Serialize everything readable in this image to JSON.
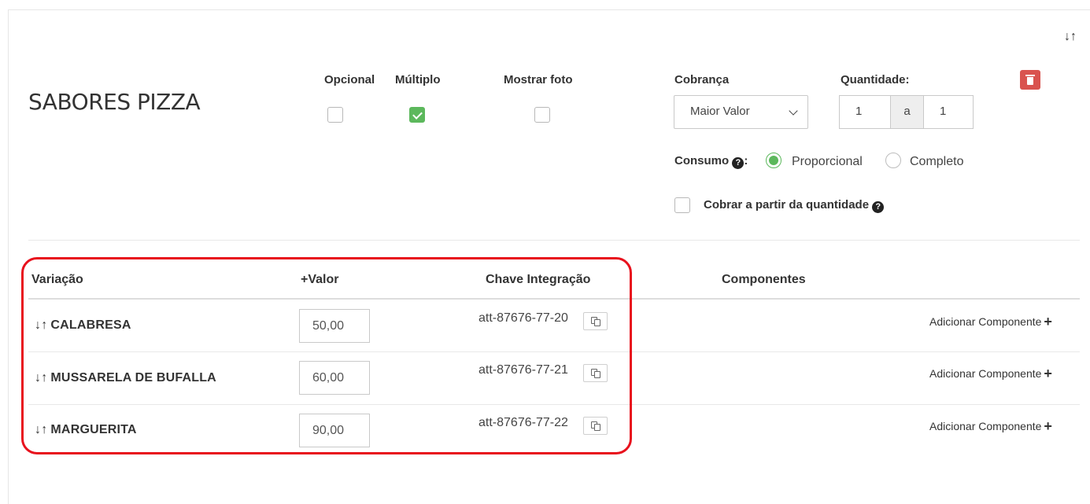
{
  "group": {
    "title": "SABORES PIZZA",
    "sort_icon": "↓↑",
    "delete_icon": "trash-icon"
  },
  "options": {
    "opcional": {
      "label": "Opcional",
      "checked": false
    },
    "multiplo": {
      "label": "Múltiplo",
      "checked": true
    },
    "mostrar_foto": {
      "label": "Mostrar foto",
      "checked": false
    }
  },
  "cobranca": {
    "label": "Cobrança",
    "selected": "Maior Valor"
  },
  "quantidade": {
    "label": "Quantidade:",
    "min": "1",
    "separator": "a",
    "max": "1"
  },
  "consumo": {
    "label": "Consumo",
    "colon": ":",
    "options": [
      "Proporcional",
      "Completo"
    ],
    "selected": "Proporcional"
  },
  "cobrar_partir": {
    "label": "Cobrar a partir da quantidade",
    "checked": false
  },
  "table": {
    "headers": {
      "variacao": "Variação",
      "valor": "+Valor",
      "chave": "Chave Integração",
      "componentes": "Componentes"
    },
    "rows": [
      {
        "name": "CALABRESA",
        "valor": "50,00",
        "chave": "att-87676-77-20",
        "add_label": "Adicionar Componente"
      },
      {
        "name": "MUSSARELA DE BUFALLA",
        "valor": "60,00",
        "chave": "att-87676-77-21",
        "add_label": "Adicionar Componente"
      },
      {
        "name": "MARGUERITA",
        "valor": "90,00",
        "chave": "att-87676-77-22",
        "add_label": "Adicionar Componente"
      }
    ]
  },
  "colors": {
    "success": "#5cb85c",
    "danger": "#d9534f",
    "highlight": "#e8111d"
  }
}
